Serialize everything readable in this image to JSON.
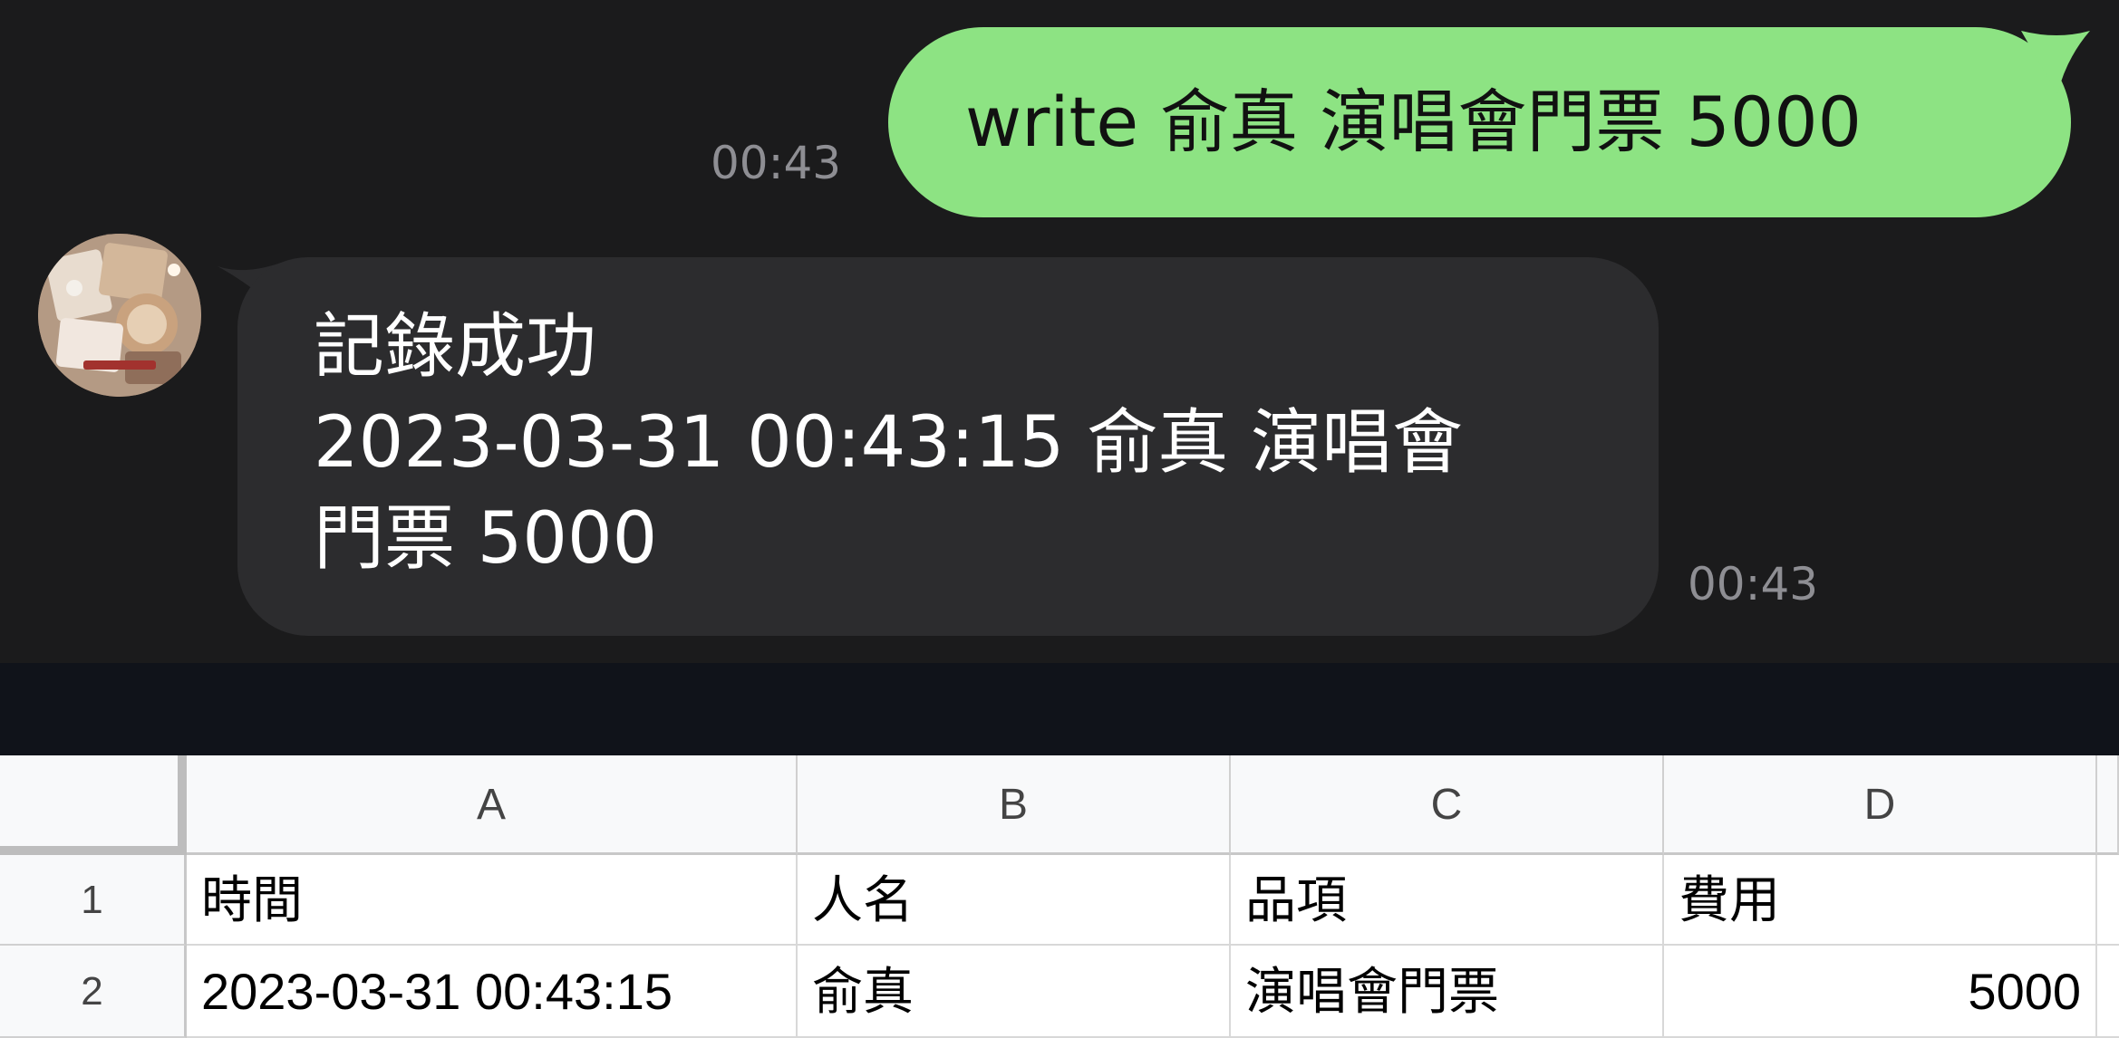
{
  "chat": {
    "outgoing": {
      "text": "write 俞真 演唱會門票 5000",
      "time": "00:43"
    },
    "incoming": {
      "lines": [
        "記錄成功",
        "2023-03-31 00:43:15 俞真 演唱會",
        "門票 5000"
      ],
      "time": "00:43"
    },
    "colors": {
      "background": "#1b1b1c",
      "outgoing_bubble": "#8de383",
      "incoming_bubble": "#2c2c2e",
      "timestamp": "#8e8e93"
    }
  },
  "sheet": {
    "columns": [
      "A",
      "B",
      "C",
      "D"
    ],
    "rows": [
      {
        "number": "1",
        "cells": [
          "時間",
          "人名",
          "品項",
          "費用"
        ]
      },
      {
        "number": "2",
        "cells": [
          "2023-03-31 00:43:15",
          "俞真",
          "演唱會門票",
          "5000"
        ]
      }
    ]
  }
}
